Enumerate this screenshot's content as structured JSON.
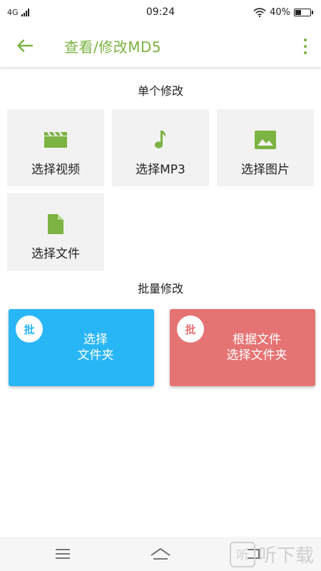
{
  "status_bar": {
    "network": "4G",
    "time": "09:24",
    "battery": "40%",
    "battery_level": 0.4
  },
  "app_bar": {
    "title": "查看/修改MD5"
  },
  "single": {
    "title": "单个修改",
    "tiles": [
      {
        "label": "选择视频",
        "icon": "video-clapper-icon"
      },
      {
        "label": "选择MP3",
        "icon": "music-note-icon"
      },
      {
        "label": "选择图片",
        "icon": "image-icon"
      },
      {
        "label": "选择文件",
        "icon": "file-icon"
      }
    ]
  },
  "batch": {
    "title": "批量修改",
    "cards": [
      {
        "badge": "批",
        "line1": "选择",
        "line2": "文件夹",
        "color": "#29b6f6"
      },
      {
        "badge": "批",
        "line1": "根据文件",
        "line2": "选择文件夹",
        "color": "#e57373"
      }
    ]
  },
  "watermark": {
    "logo": "听",
    "text": "听下载"
  },
  "colors": {
    "accent": "#7cb342"
  }
}
